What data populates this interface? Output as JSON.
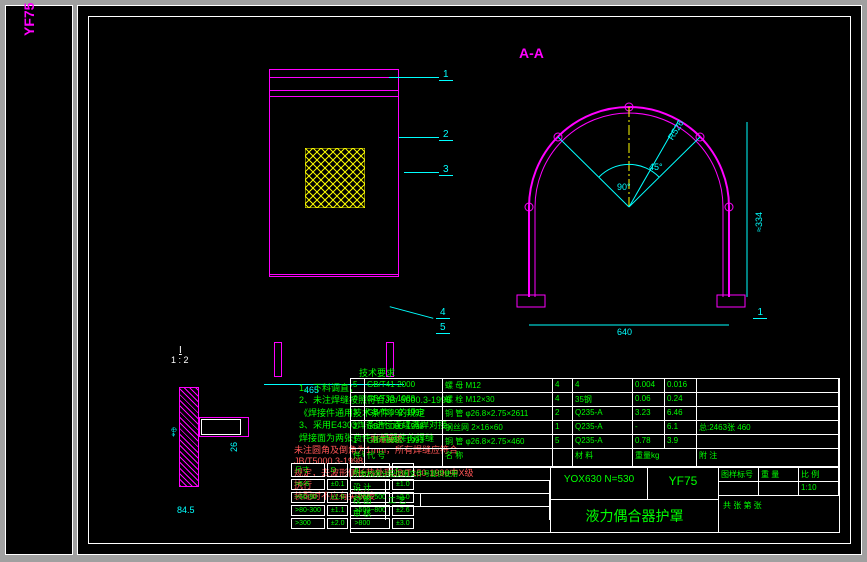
{
  "drawing_code": "YF75",
  "section_label": "A-A",
  "scale_label": "I",
  "scale_ratio": "1 : 2",
  "callouts": {
    "c1": "1",
    "c2": "2",
    "c3": "3",
    "c4": "4",
    "c5": "5"
  },
  "dims": {
    "d465": "465",
    "d640": "640",
    "d334": "≈334",
    "d526": "R526",
    "d90": "90°",
    "d45": "45°",
    "d84": "84.5",
    "d26": "26"
  },
  "notes": {
    "header": "技术要求",
    "n1": "1、下料调直；",
    "n2": "2、未注焊缝按照符合JB/ 5000.3-1998",
    "n2b": "《焊接件通用技术条件》的规定",
    "n3": "3、采用E4303焊条进行连续满焊对接，",
    "n3b": "焊接面为两张费件专辑器件的焊缝"
  },
  "mfg": {
    "header": "制造要求",
    "line1": "未注圆角及倒角为1mm，所有焊缝应符合JB/T5000.3-1998",
    "line2": "规定，去波形侧长热处理JB/T150-1990中X级执行",
    "line3": "装配时不应有尖锐棱"
  },
  "tol": {
    "h1": "尺寸",
    "h2": "D",
    "h3": "h",
    "h4": "f",
    "r1c1": ">6-6",
    "r1c2": "±0.1",
    "r1c3": "-",
    "r1c4": "±1.0",
    "r2c1": ">50-80",
    "r2c2": "±1.0",
    "r2c3": ">200~500",
    "r2c4": "±2.0",
    "r3c1": ">80-300",
    "r3c2": "±1.1",
    "r3c3": ">500~800",
    "r3c4": "±2.6",
    "r4c1": ">300",
    "r4c2": "±2.0",
    "r4c3": ">800",
    "r4c4": "±3.0"
  },
  "bom": {
    "headers": {
      "h1": "件号",
      "h2": "代  号",
      "h3": "名  称",
      "h4": "材  料",
      "h5": "单重",
      "h6": "重量kg",
      "h7": "附  注"
    },
    "rows": [
      {
        "n": "5",
        "std": "GB/T41-2000",
        "name": "螺 母 M12",
        "qty": "4",
        "mat": "4",
        "w1": "0.004",
        "w2": "0.016"
      },
      {
        "n": "4",
        "std": "GB/T33-1988",
        "name": "螺 栓 M12×30",
        "qty": "4",
        "mat": "35钢",
        "w1": "0.06",
        "w2": "0.24"
      },
      {
        "n": "3",
        "std": "GB/T3092-1993",
        "name": "铜 管 φ26.8×2.75×2611",
        "qty": "2",
        "mat": "Q235-A",
        "w1": "3.23",
        "w2": "6.46"
      },
      {
        "n": "2",
        "std": "GB/T3090-1998",
        "name": "钢丝网 2×16×60",
        "qty": "1",
        "mat": "Q235-A",
        "w1": "-",
        "w2": "6.1",
        "note": "总:2463张 460"
      },
      {
        "n": "1",
        "std": "GB/T3092-1993",
        "name": "铜 管 φ26.8×2.75×460",
        "qty": "5",
        "mat": "Q235-A",
        "w1": "0.78",
        "w2": "3.9"
      }
    ]
  },
  "title_block": {
    "product": "YOX630 N=530",
    "code": "YF75",
    "title": "液力偶合器护罩",
    "sig_labels": {
      "l1": "所有权限分配仅限文件号提供使用",
      "l2": "设 计",
      "l3": "校 图",
      "l4": "审 核",
      "l5": "工 艺"
    },
    "right": {
      "l1": "图样标号",
      "l2": "重 量",
      "l3": "比 例",
      "scale": "1:10",
      "l4": "共  张  第  张"
    }
  }
}
